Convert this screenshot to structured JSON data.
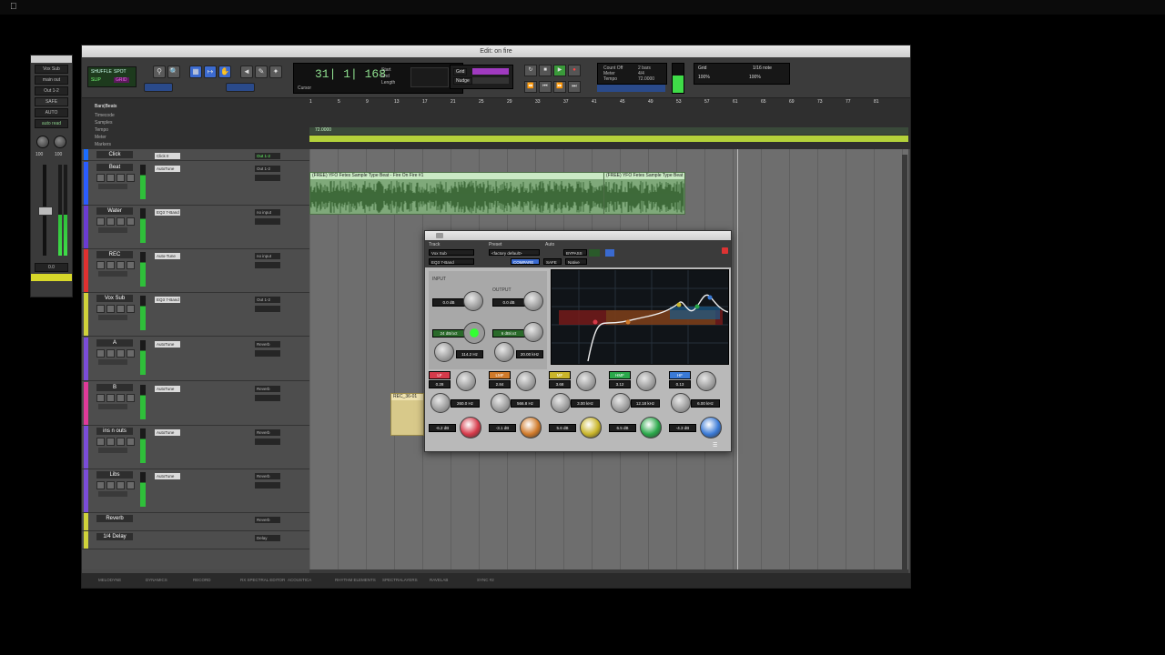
{
  "menubar": {
    "apple": ""
  },
  "mixer": {
    "header": "",
    "insert_label": "AUTO",
    "send_label": "auto read",
    "rows": [
      "Vox Sub",
      "main out",
      "Out 1-2"
    ],
    "volume": "0.0",
    "pan_left": "100",
    "pan_right": "100",
    "safe": "SAFE"
  },
  "window": {
    "title": "Edit: on fire"
  },
  "toolbar": {
    "modes": [
      "SHUFFLE",
      "SPOT",
      "SLIP",
      "GRID"
    ],
    "tool_icons": [
      "zoom",
      "trim",
      "grabber",
      "scrub",
      "pencil"
    ],
    "counter_main": "31| 1| 168",
    "counter_labels": [
      "Start",
      "End",
      "Length"
    ],
    "counter_sub": "Cursor",
    "transport": [
      "⏮",
      "⏪",
      "▶",
      "■",
      "●"
    ],
    "grid_label": "Grid",
    "nudge_label": "Nudge",
    "grid_value": "1/16 note",
    "strength": "100%",
    "swing": "100%",
    "count_off": "Count Off",
    "meter": "Meter",
    "tempo": "Tempo",
    "tempo_value": "72.0000",
    "bars": "2 bars",
    "meter_value": "4/4"
  },
  "rulers": {
    "labels": [
      "Bars|Beats",
      "Timecode",
      "Samples",
      "Tempo",
      "Meter",
      "Markers"
    ],
    "bars": [
      "1",
      "5",
      "9",
      "13",
      "17",
      "21",
      "25",
      "29",
      "33",
      "37",
      "41",
      "45",
      "49",
      "53",
      "57",
      "61",
      "65",
      "69",
      "73",
      "77",
      "81"
    ],
    "tempo_marker": "72.0000",
    "meter_marker": "4/4"
  },
  "tracks": [
    {
      "name": "Click",
      "color": "#1a6cff",
      "insert": "Click II",
      "io": "Out 1-2"
    },
    {
      "name": "Beat",
      "color": "#2a5cff",
      "insert": "AutoTune",
      "io": "Out 1-2"
    },
    {
      "name": "Water",
      "color": "#6a3bd1",
      "insert": "EQ3 7-Band",
      "io": "no input"
    },
    {
      "name": "REC",
      "color": "#e03030",
      "insert": "Auto-Tune",
      "io": "no input"
    },
    {
      "name": "Vox Sub",
      "color": "#cfd23a",
      "insert": "EQ3 7-Band",
      "io": "Out 1-2"
    },
    {
      "name": "A",
      "color": "#7a4cd9",
      "insert": "AutoTune",
      "io": "Reverb"
    },
    {
      "name": "B",
      "color": "#e03a9a",
      "insert": "AutoTune",
      "io": "Reverb"
    },
    {
      "name": "ins n outs",
      "color": "#7a4cd9",
      "insert": "AutoTune",
      "io": "Reverb"
    },
    {
      "name": "Libs",
      "color": "#7a4cd9",
      "insert": "AutoTune",
      "io": "Reverb"
    },
    {
      "name": "Reverb",
      "color": "#cfd23a",
      "insert": "",
      "io": "Reverb"
    },
    {
      "name": "1/4 Delay",
      "color": "#cfd23a",
      "insert": "",
      "io": "Delay"
    }
  ],
  "clips": [
    {
      "name": "(FREE) YFO Fetes Sample Type Beat - Fire On Fire #1"
    },
    {
      "name": "(FREE) YFO Fetes Sample Type Beat"
    },
    {
      "name": "REC_36-01"
    }
  ],
  "bottom_tabs": [
    "MELODYNE",
    "DYNAMICS",
    "RECORD",
    "RX SPECTRAL EDITOR",
    "ACOUSTICA",
    "RHYTHM ELEMENTS",
    "SPECTRALAYERS",
    "RAVELAB",
    "SYNC #2"
  ],
  "plugin": {
    "track_label": "Track",
    "preset_label": "Preset",
    "auto_label": "Auto",
    "track_name": "Vox Sub",
    "preset_name": "<factory default>",
    "plugin_name": "EQ3 7-Band",
    "compare": "COMPARE",
    "bypass": "BYPASS",
    "safe": "SAFE",
    "native": "Native",
    "input_label": "INPUT",
    "input_value": "0.0 dB",
    "output_label": "OUTPUT",
    "output_value": "0.0 dB",
    "hpf_value": "24 dB/oct",
    "hpf_freq": "114.2 Hz",
    "lpf_value": "6 dB/oct",
    "lpf_freq": "20.00 kHz",
    "bands": [
      {
        "label": "LF",
        "q": "0.28",
        "freq": "260.0 Hz",
        "gain": "-6.2 dB",
        "color": "#d63a4a"
      },
      {
        "label": "LMF",
        "q": "2.84",
        "freq": "566.8 Hz",
        "gain": "-3.1 dB",
        "color": "#d07a2a"
      },
      {
        "label": "MF",
        "q": "3.68",
        "freq": "3.00 kHz",
        "gain": "5.6 dB",
        "color": "#c9b52a"
      },
      {
        "label": "HMF",
        "q": "3.12",
        "freq": "12.18 kHz",
        "gain": "6.5 dB",
        "color": "#2aa84a"
      },
      {
        "label": "HF",
        "q": "0.13",
        "freq": "6.00 kHz",
        "gain": "-4.3 dB",
        "color": "#3a7ad6"
      }
    ]
  }
}
